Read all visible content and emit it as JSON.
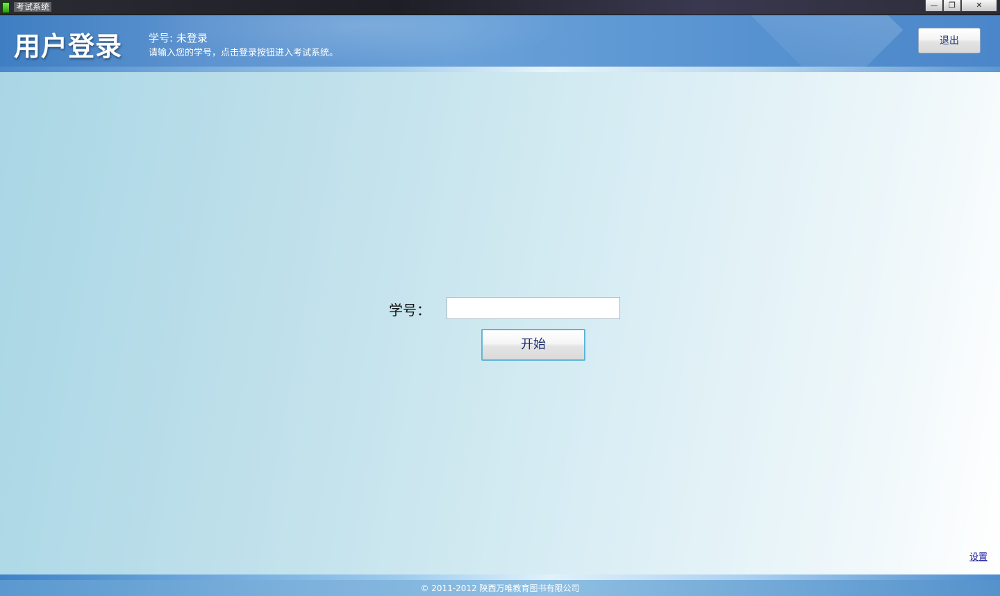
{
  "window": {
    "title": "考试系统",
    "controls": {
      "minimize": "—",
      "restore": "❐",
      "close": "✕"
    }
  },
  "header": {
    "title": "用户登录",
    "status": "学号: 未登录",
    "instruction": "请输入您的学号，点击登录按钮进入考试系统。",
    "exit_label": "退出"
  },
  "login": {
    "student_id_label": "学号：",
    "student_id_value": "",
    "start_label": "开始"
  },
  "settings_label": "设置",
  "footer": {
    "copyright": "© 2011-2012 陕西万唯教育图书有限公司"
  }
}
